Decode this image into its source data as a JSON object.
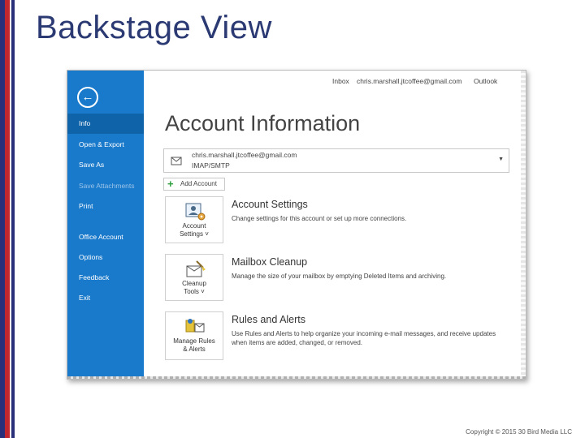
{
  "slide": {
    "title": "Backstage View",
    "copyright": "Copyright © 2015 30 Bird Media LLC"
  },
  "outlook": {
    "topbar": {
      "folder": "Inbox",
      "email": "chris.marshall.jtcoffee@gmail.com",
      "app": "Outlook"
    },
    "nav": {
      "items": [
        {
          "label": "Info",
          "state": "active"
        },
        {
          "label": "Open & Export",
          "state": "normal"
        },
        {
          "label": "Save As",
          "state": "normal"
        },
        {
          "label": "Save Attachments",
          "state": "disabled"
        },
        {
          "label": "Print",
          "state": "normal"
        },
        {
          "label": "Office Account",
          "state": "normal"
        },
        {
          "label": "Options",
          "state": "normal"
        },
        {
          "label": "Feedback",
          "state": "normal"
        },
        {
          "label": "Exit",
          "state": "normal"
        }
      ]
    },
    "main": {
      "title": "Account Information",
      "account": {
        "email": "chris.marshall.jtcoffee@gmail.com",
        "type": "IMAP/SMTP"
      },
      "add_account_label": "Add Account",
      "sections": [
        {
          "tile_line1": "Account",
          "tile_line2": "Settings ˅",
          "title": "Account Settings",
          "desc": "Change settings for this account or set up more connections.",
          "icon": "account-settings-icon"
        },
        {
          "tile_line1": "Cleanup",
          "tile_line2": "Tools ˅",
          "title": "Mailbox Cleanup",
          "desc": "Manage the size of your mailbox by emptying Deleted Items and archiving.",
          "icon": "cleanup-tools-icon"
        },
        {
          "tile_line1": "Manage Rules",
          "tile_line2": "& Alerts",
          "title": "Rules and Alerts",
          "desc": "Use Rules and Alerts to help organize your incoming e-mail messages, and receive updates when items are added, changed, or removed.",
          "icon": "rules-alerts-icon"
        }
      ]
    },
    "colors": {
      "sidebar": "#1979ca",
      "sidebar_active": "#0f63a8",
      "title_blue": "#2b3a73",
      "add_green": "#2e9e3e"
    }
  }
}
